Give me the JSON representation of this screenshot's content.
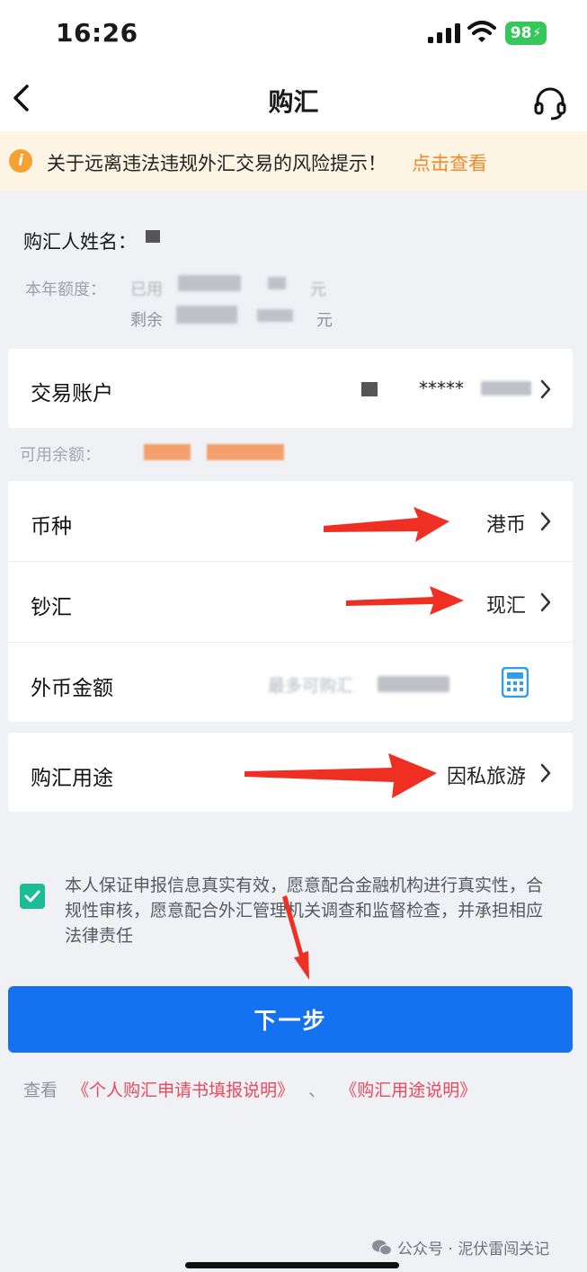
{
  "status_bar": {
    "time": "16:26",
    "battery": "98"
  },
  "nav": {
    "title": "购汇"
  },
  "notice": {
    "text": "关于远离违法违规外汇交易的风险提示！",
    "link": "点击查看"
  },
  "info": {
    "name_label": "购汇人姓名：",
    "quota_label": "本年额度：",
    "used_prefix": "已用",
    "remain_label": "剩余",
    "unit": "元"
  },
  "account": {
    "label": "交易账户",
    "masked_number": "*****"
  },
  "balance": {
    "label": "可用余额："
  },
  "form": {
    "currency": {
      "label": "币种",
      "value": "港币"
    },
    "cash_type": {
      "label": "钞汇",
      "value": "现汇"
    },
    "amount": {
      "label": "外币金额",
      "placeholder": "最多可购汇"
    },
    "purpose": {
      "label": "购汇用途",
      "value": "因私旅游"
    }
  },
  "declaration": {
    "text": "本人保证申报信息真实有效，愿意配合金融机构进行真实性，合规性审核，愿意配合外汇管理机关调查和监督检查，并承担相应法律责任",
    "checked": true
  },
  "next_button": {
    "label": "下一步"
  },
  "footer": {
    "prefix": "查看",
    "link1": "《个人购汇申请书填报说明》",
    "separator": "、",
    "link2": "《购汇用途说明》"
  },
  "watermark": {
    "text": "公众号 · 泥伏雷闯关记"
  },
  "colors": {
    "primary": "#1472f0",
    "notice_bg": "#fdf4e3",
    "notice_link": "#ee8a2e",
    "check": "#1bbd95",
    "link_red": "#e8485c",
    "arrow_red": "#ee2f22"
  }
}
